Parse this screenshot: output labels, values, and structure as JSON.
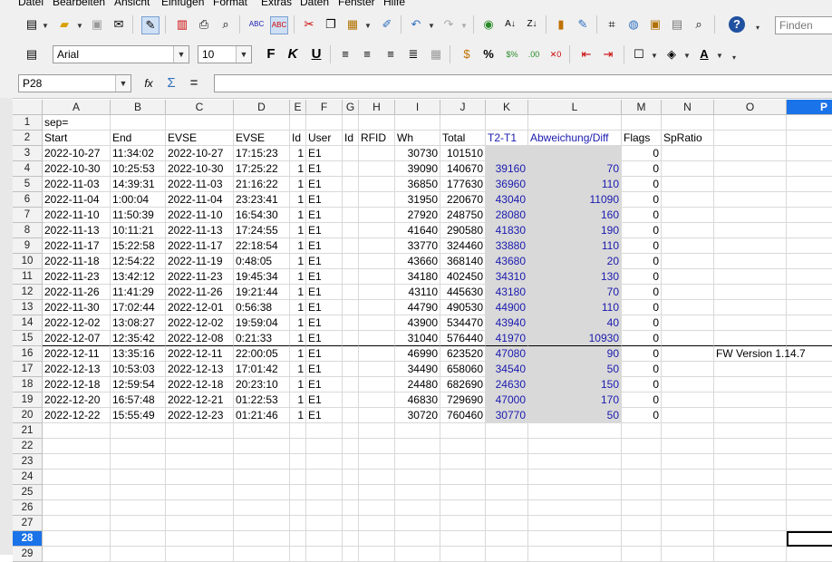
{
  "menu": [
    "Datei",
    "Bearbeiten",
    "Ansicht",
    "Einfügen",
    "Format",
    "Extras",
    "Daten",
    "Fenster",
    "Hilfe"
  ],
  "find_placeholder": "Finden",
  "font_name": "Arial",
  "font_size": "10",
  "name_box": "P28",
  "formula_content": "",
  "columns": [
    {
      "id": "A",
      "w": 75
    },
    {
      "id": "B",
      "w": 61
    },
    {
      "id": "C",
      "w": 75
    },
    {
      "id": "D",
      "w": 62
    },
    {
      "id": "E",
      "w": 18
    },
    {
      "id": "F",
      "w": 40
    },
    {
      "id": "G",
      "w": 18
    },
    {
      "id": "H",
      "w": 40
    },
    {
      "id": "I",
      "w": 50
    },
    {
      "id": "J",
      "w": 50
    },
    {
      "id": "K",
      "w": 47
    },
    {
      "id": "L",
      "w": 103
    },
    {
      "id": "M",
      "w": 44
    },
    {
      "id": "N",
      "w": 58
    },
    {
      "id": "O",
      "w": 80
    },
    {
      "id": "P",
      "w": 83
    }
  ],
  "selected_column": "P",
  "selected_row": 28,
  "rows": [
    {
      "n": 1,
      "cells": {
        "A": "sep="
      }
    },
    {
      "n": 2,
      "cells": {
        "A": "Start",
        "B": "End",
        "C": "EVSE",
        "D": "EVSE",
        "E": "Id",
        "F": "User",
        "G": "Id",
        "H": "RFID",
        "I": "Wh",
        "J": "Total",
        "K": "T2-T1",
        "L": "Abweichung/Diff",
        "M": "Flags",
        "N": "SpRatio"
      }
    },
    {
      "n": 3,
      "cells": {
        "A": "2022-10-27",
        "B": "11:34:02",
        "C": "2022-10-27",
        "D": "17:15:23",
        "E": "1",
        "F": "E1",
        "I": "30730",
        "J": "101510",
        "K": "",
        "L": "",
        "M": "0"
      }
    },
    {
      "n": 4,
      "cells": {
        "A": "2022-10-30",
        "B": "10:25:53",
        "C": "2022-10-30",
        "D": "17:25:22",
        "E": "1",
        "F": "E1",
        "I": "39090",
        "J": "140670",
        "K": "39160",
        "L": "70",
        "M": "0"
      }
    },
    {
      "n": 5,
      "cells": {
        "A": "2022-11-03",
        "B": "14:39:31",
        "C": "2022-11-03",
        "D": "21:16:22",
        "E": "1",
        "F": "E1",
        "I": "36850",
        "J": "177630",
        "K": "36960",
        "L": "110",
        "M": "0"
      }
    },
    {
      "n": 6,
      "cells": {
        "A": "2022-11-04",
        "B": "1:00:04",
        "C": "2022-11-04",
        "D": "23:23:41",
        "E": "1",
        "F": "E1",
        "I": "31950",
        "J": "220670",
        "K": "43040",
        "L": "11090",
        "M": "0"
      }
    },
    {
      "n": 7,
      "cells": {
        "A": "2022-11-10",
        "B": "11:50:39",
        "C": "2022-11-10",
        "D": "16:54:30",
        "E": "1",
        "F": "E1",
        "I": "27920",
        "J": "248750",
        "K": "28080",
        "L": "160",
        "M": "0"
      }
    },
    {
      "n": 8,
      "cells": {
        "A": "2022-11-13",
        "B": "10:11:21",
        "C": "2022-11-13",
        "D": "17:24:55",
        "E": "1",
        "F": "E1",
        "I": "41640",
        "J": "290580",
        "K": "41830",
        "L": "190",
        "M": "0"
      }
    },
    {
      "n": 9,
      "cells": {
        "A": "2022-11-17",
        "B": "15:22:58",
        "C": "2022-11-17",
        "D": "22:18:54",
        "E": "1",
        "F": "E1",
        "I": "33770",
        "J": "324460",
        "K": "33880",
        "L": "110",
        "M": "0"
      }
    },
    {
      "n": 10,
      "cells": {
        "A": "2022-11-18",
        "B": "12:54:22",
        "C": "2022-11-19",
        "D": "0:48:05",
        "E": "1",
        "F": "E1",
        "I": "43660",
        "J": "368140",
        "K": "43680",
        "L": "20",
        "M": "0"
      }
    },
    {
      "n": 11,
      "cells": {
        "A": "2022-11-23",
        "B": "13:42:12",
        "C": "2022-11-23",
        "D": "19:45:34",
        "E": "1",
        "F": "E1",
        "I": "34180",
        "J": "402450",
        "K": "34310",
        "L": "130",
        "M": "0"
      }
    },
    {
      "n": 12,
      "cells": {
        "A": "2022-11-26",
        "B": "11:41:29",
        "C": "2022-11-26",
        "D": "19:21:44",
        "E": "1",
        "F": "E1",
        "I": "43110",
        "J": "445630",
        "K": "43180",
        "L": "70",
        "M": "0"
      }
    },
    {
      "n": 13,
      "cells": {
        "A": "2022-11-30",
        "B": "17:02:44",
        "C": "2022-12-01",
        "D": "0:56:38",
        "E": "1",
        "F": "E1",
        "I": "44790",
        "J": "490530",
        "K": "44900",
        "L": "110",
        "M": "0"
      }
    },
    {
      "n": 14,
      "cells": {
        "A": "2022-12-02",
        "B": "13:08:27",
        "C": "2022-12-02",
        "D": "19:59:04",
        "E": "1",
        "F": "E1",
        "I": "43900",
        "J": "534470",
        "K": "43940",
        "L": "40",
        "M": "0"
      }
    },
    {
      "n": 15,
      "cells": {
        "A": "2022-12-07",
        "B": "12:35:42",
        "C": "2022-12-08",
        "D": "0:21:33",
        "E": "1",
        "F": "E1",
        "I": "31040",
        "J": "576440",
        "K": "41970",
        "L": "10930",
        "M": "0"
      }
    },
    {
      "n": 16,
      "cells": {
        "A": "2022-12-11",
        "B": "13:35:16",
        "C": "2022-12-11",
        "D": "22:00:05",
        "E": "1",
        "F": "E1",
        "I": "46990",
        "J": "623520",
        "K": "47080",
        "L": "90",
        "M": "0",
        "O": "FW Version 1.14.7"
      }
    },
    {
      "n": 17,
      "cells": {
        "A": "2022-12-13",
        "B": "10:53:03",
        "C": "2022-12-13",
        "D": "17:01:42",
        "E": "1",
        "F": "E1",
        "I": "34490",
        "J": "658060",
        "K": "34540",
        "L": "50",
        "M": "0"
      }
    },
    {
      "n": 18,
      "cells": {
        "A": "2022-12-18",
        "B": "12:59:54",
        "C": "2022-12-18",
        "D": "20:23:10",
        "E": "1",
        "F": "E1",
        "I": "24480",
        "J": "682690",
        "K": "24630",
        "L": "150",
        "M": "0"
      }
    },
    {
      "n": 19,
      "cells": {
        "A": "2022-12-20",
        "B": "16:57:48",
        "C": "2022-12-21",
        "D": "01:22:53",
        "E": "1",
        "F": "E1",
        "I": "46830",
        "J": "729690",
        "K": "47000",
        "L": "170",
        "M": "0"
      }
    },
    {
      "n": 20,
      "cells": {
        "A": "2022-12-22",
        "B": "15:55:49",
        "C": "2022-12-23",
        "D": "01:21:46",
        "E": "1",
        "F": "E1",
        "I": "30720",
        "J": "760460",
        "K": "30770",
        "L": "50",
        "M": "0"
      }
    },
    {
      "n": 21,
      "cells": {}
    },
    {
      "n": 22,
      "cells": {}
    },
    {
      "n": 23,
      "cells": {}
    },
    {
      "n": 24,
      "cells": {}
    },
    {
      "n": 25,
      "cells": {}
    },
    {
      "n": 26,
      "cells": {}
    },
    {
      "n": 27,
      "cells": {}
    },
    {
      "n": 28,
      "cells": {}
    },
    {
      "n": 29,
      "cells": {}
    }
  ],
  "right_aligned_columns": [
    "E",
    "I",
    "J",
    "K",
    "L",
    "M"
  ],
  "blue_columns": [
    "K",
    "L"
  ],
  "shaded_columns": [
    "K",
    "L"
  ],
  "shaded_rows_from": 3,
  "shaded_rows_to": 20,
  "colors": {
    "selection": "#1a73e8",
    "header_bg": "#f2f2f2",
    "link_text": "#1a1ab0",
    "shade": "#d9d9d9"
  }
}
